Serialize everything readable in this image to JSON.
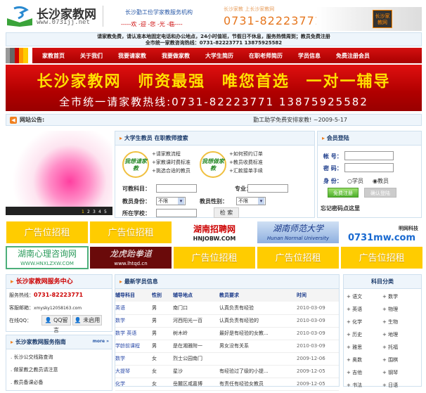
{
  "header": {
    "title": "长沙家教网",
    "url": "www.0731jj.net",
    "slogan": "长沙勤工俭学家教服务机构",
    "welcome": "-----欢 -迎 -您 -光 -临----",
    "faded_text": "长沙家教 上长沙家教网",
    "phone": "0731-82223771",
    "badge": "长沙家教网"
  },
  "notice": {
    "line1": "请家教免费，请认准本地固定电话和办公地点，24小时值班，节假日不休息，服务热情周到；教员免费注册",
    "line2": "全市统一家教咨询热线：0731-82223771 13875925582"
  },
  "nav": [
    "家教首页",
    "关于我们",
    "我要请家教",
    "我要做家教",
    "大学生简历",
    "在职老师简历",
    "学员信息",
    "免费注册会员"
  ],
  "banner": {
    "line1": "长沙家教网 师资最强 唯您首选 一对一辅导",
    "line2": "全市统一请家教热线:0731-82223771 13875925582"
  },
  "announcement": {
    "label": "网站公告:",
    "text": "勤工助学免费安排家教! ~2009-5-17"
  },
  "flash": {
    "pages": [
      "1",
      "2",
      "3",
      "4",
      "5"
    ]
  },
  "search": {
    "title": "大学生教员 在职教师搜索",
    "hire_badge": "我想请家教",
    "teach_badge": "我想做家教",
    "hire_links": [
      "+请家教流程",
      "+家教课时费标准",
      "+挑选合适的教员"
    ],
    "teach_links": [
      "+如何预约订单",
      "+教员收费标准",
      "+汇款接单手续"
    ],
    "subject_label": "可教科目：",
    "major_label": "专业：",
    "identity_label": "教员身份：",
    "identity_value": "不限",
    "gender_label": "教员性别：",
    "gender_value": "不限",
    "school_label": "所在学校：",
    "search_button": "检 索"
  },
  "login": {
    "title": "会员登陆",
    "account_label": "帐 号：",
    "password_label": "密 码：",
    "role_label": "身 份：",
    "role_student": "学员",
    "role_teacher": "教员",
    "register_button": "免费注册",
    "login_button": "确认登陆",
    "forgot": "忘记密码点这里"
  },
  "ads": {
    "row1": [
      "广告位招租",
      "广告位招租",
      "湖南招聘网",
      "湖南师范大学",
      "0731mw.com"
    ],
    "row1_sub": [
      "HNJOBW.COM",
      "Hunan Normal University",
      "明网科技"
    ],
    "row2": [
      "湖南心理咨询网",
      "龙虎跆拳道",
      "广告位招租",
      "广告位招租",
      "广告位招租"
    ],
    "row2_sub": [
      "WWW.HNXLZXW.COM",
      "www.lhtqd.cn"
    ]
  },
  "service": {
    "title": "长沙家教网服务中心",
    "hotline_label": "服务热线：",
    "hotline": "0731-82223771",
    "email_label": "客服邮箱：",
    "email": "xmysky12058163.com",
    "qq_label": "在线QQ：",
    "qq1": "QQ留言",
    "qq2": "未启用"
  },
  "guide": {
    "title": "长沙家教网服务指南",
    "more": "more »",
    "items": [
      ". 长沙公交线路查询",
      ". 做家教之教员请注意",
      ". 教员备课必备"
    ]
  },
  "students": {
    "title": "最新学员信息",
    "headers": [
      "辅导科目",
      "性别",
      "辅导地点",
      "教员要求",
      "时间"
    ],
    "rows": [
      [
        "英语",
        "男",
        "南门口",
        "认真负责有经验",
        "2010-03-09"
      ],
      [
        "数学",
        "男",
        "河西阳光一百",
        "认真负责有经验的",
        "2010-03-09"
      ],
      [
        "数学 英语",
        "男",
        "树木岭",
        "最好是有经验的女教...",
        "2010-03-09"
      ],
      [
        "学龄前课程",
        "男",
        "是在湘雅附一",
        "男女没有关系",
        "2010-03-09"
      ],
      [
        "数学",
        "女",
        "烈士公园南门",
        "",
        "2009-12-06"
      ],
      [
        "大提琴",
        "女",
        "星沙",
        "有经验过了级的小提...",
        "2009-12-05"
      ],
      [
        "化学",
        "女",
        "岳麓区咸嘉博",
        "有责任有经验女教员",
        "2009-12-05"
      ]
    ]
  },
  "categories": {
    "title": "科目分类",
    "items": [
      "+ 语文",
      "+ 数学",
      "+ 英语",
      "+ 物理",
      "+ 化学",
      "+ 生物",
      "+ 历史",
      "+ 地理",
      "+ 雅思",
      "+ 托福",
      "+ 奥数",
      "+ 围棋",
      "+ 吉他",
      "+ 钢琴",
      "+ 书法",
      "+ 日语"
    ]
  }
}
